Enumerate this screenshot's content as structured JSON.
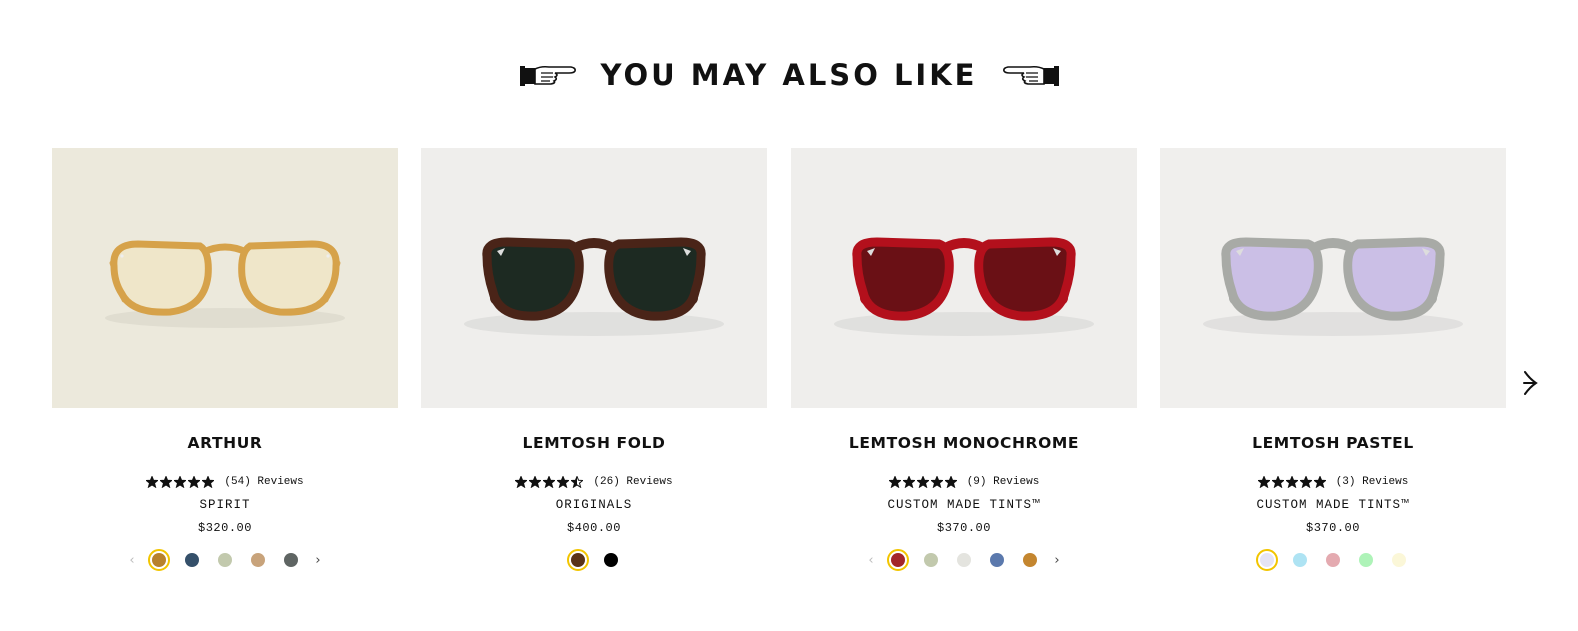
{
  "section": {
    "title": "YOU MAY ALSO LIKE"
  },
  "icons": {
    "left": "pointing-hand-right-icon",
    "right": "pointing-hand-left-icon",
    "next": "carousel-next-arrow-icon"
  },
  "products": [
    {
      "name": "ARTHUR",
      "rating": 5,
      "reviews": "(54) Reviews",
      "collection": "SPIRIT",
      "price": "$320.00",
      "image_bg": "#ece9dc",
      "frame_color": "#d6a24a",
      "lens_color": "#efe6c9",
      "frame_style": "round",
      "show_swatch_arrows": true,
      "swatches": [
        "#b8822c",
        "#35506a",
        "#c2c9ad",
        "#c8a37b",
        "#5f6563"
      ],
      "active_swatch": 0
    },
    {
      "name": "LEMTOSH FOLD",
      "rating": 4.5,
      "reviews": "(26) Reviews",
      "collection": "ORIGINALS",
      "price": "$400.00",
      "image_bg": "#efeeec",
      "frame_color": "#4a2418",
      "lens_color": "#1d2a22",
      "frame_style": "lemtosh",
      "show_swatch_arrows": false,
      "swatches": [
        "#5a3418",
        "#000000"
      ],
      "active_swatch": 0
    },
    {
      "name": "LEMTOSH MONOCHROME",
      "rating": 5,
      "reviews": "(9) Reviews",
      "collection": "CUSTOM MADE TINTS™",
      "price": "$370.00",
      "image_bg": "#efeeec",
      "frame_color": "#b3101c",
      "lens_color": "#6a1015",
      "frame_style": "lemtosh",
      "show_swatch_arrows": true,
      "swatches": [
        "#a3262a",
        "#c2c9ad",
        "#e4e4df",
        "#5b79ad",
        "#c4862f"
      ],
      "active_swatch": 0
    },
    {
      "name": "LEMTOSH PASTEL",
      "rating": 5,
      "reviews": "(3) Reviews",
      "collection": "CUSTOM MADE TINTS™",
      "price": "$370.00",
      "image_bg": "#f0efed",
      "frame_color": "#a8aaa6",
      "lens_color": "#cbbfe6",
      "frame_style": "lemtosh",
      "show_swatch_arrows": false,
      "swatches": [
        "#e5e4f5",
        "#aee3f3",
        "#e4aab0",
        "#aef3b8",
        "#fbf7d8"
      ],
      "active_swatch": 0
    }
  ]
}
